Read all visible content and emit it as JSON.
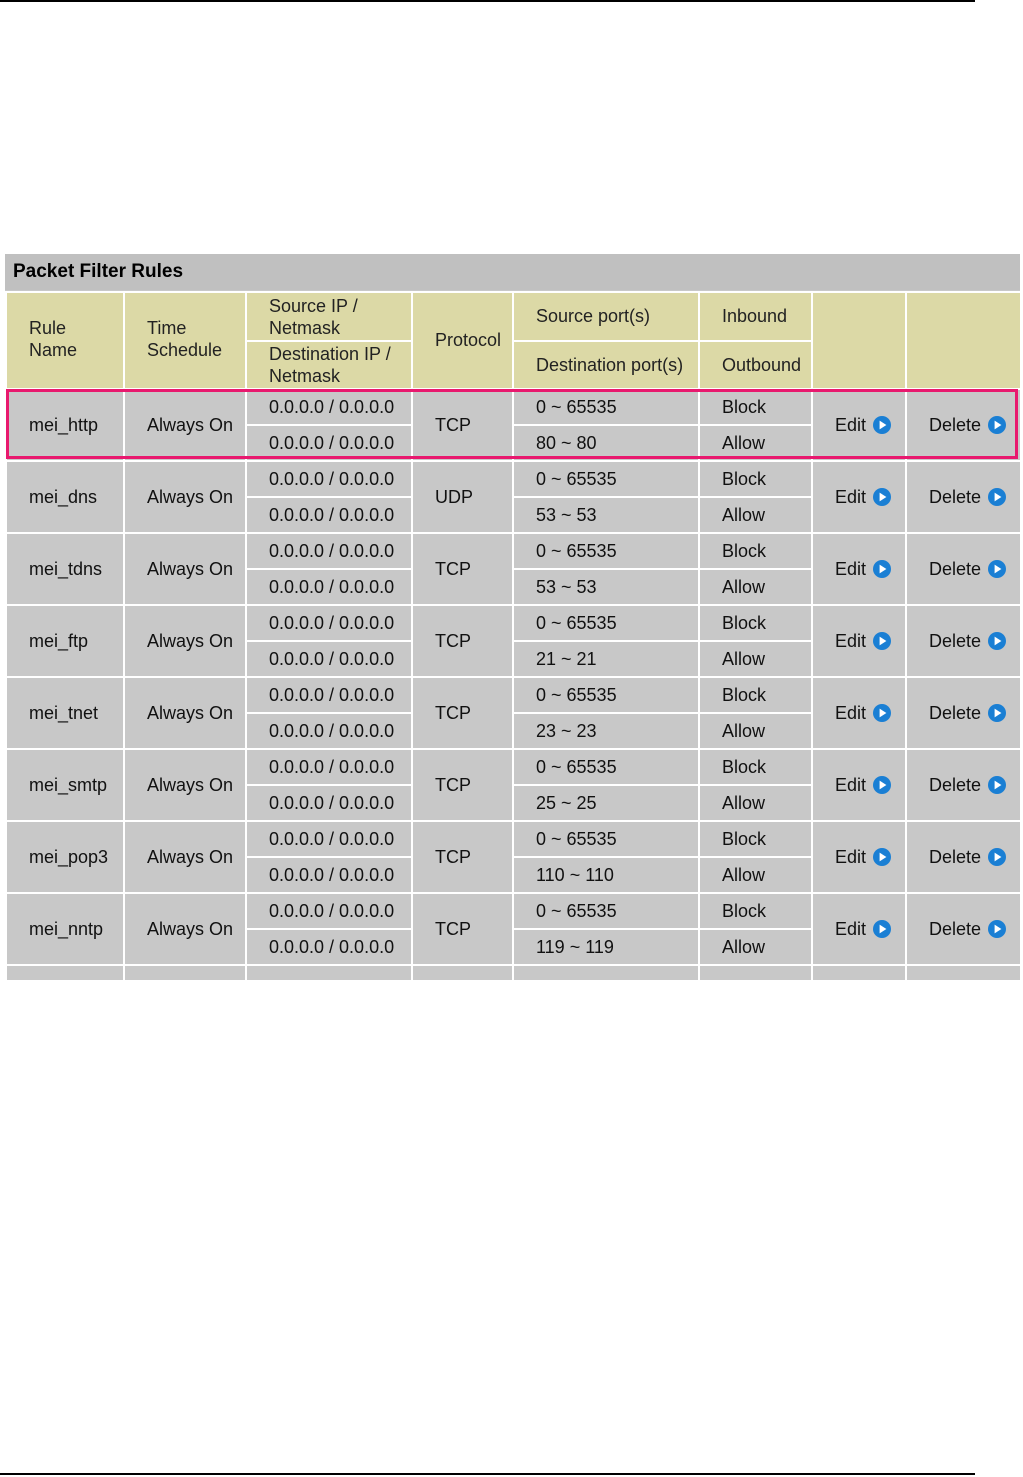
{
  "panel": {
    "title": "Packet Filter Rules"
  },
  "headers": {
    "rule_name": "Rule Name",
    "time_schedule": "Time Schedule",
    "source_ip": "Source IP / Netmask",
    "destination_ip": "Destination IP / Netmask",
    "protocol": "Protocol",
    "source_ports": "Source port(s)",
    "destination_ports": "Destination port(s)",
    "inbound": "Inbound",
    "outbound": "Outbound"
  },
  "actions": {
    "edit_label": "Edit",
    "delete_label": "Delete",
    "icon": "play-circle-icon",
    "link_color": "#2a8ad8"
  },
  "highlight_color": "#e8196e",
  "rules": [
    {
      "name": "mei_http",
      "schedule": "Always On",
      "src_ip": "0.0.0.0 / 0.0.0.0",
      "dst_ip": "0.0.0.0 / 0.0.0.0",
      "protocol": "TCP",
      "src_ports": "0 ~ 65535",
      "dst_ports": "80 ~ 80",
      "inbound": "Block",
      "outbound": "Allow"
    },
    {
      "name": "mei_dns",
      "schedule": "Always On",
      "src_ip": "0.0.0.0 / 0.0.0.0",
      "dst_ip": "0.0.0.0 / 0.0.0.0",
      "protocol": "UDP",
      "src_ports": "0 ~ 65535",
      "dst_ports": "53 ~ 53",
      "inbound": "Block",
      "outbound": "Allow"
    },
    {
      "name": "mei_tdns",
      "schedule": "Always On",
      "src_ip": "0.0.0.0 / 0.0.0.0",
      "dst_ip": "0.0.0.0 / 0.0.0.0",
      "protocol": "TCP",
      "src_ports": "0 ~ 65535",
      "dst_ports": "53 ~ 53",
      "inbound": "Block",
      "outbound": "Allow"
    },
    {
      "name": "mei_ftp",
      "schedule": "Always On",
      "src_ip": "0.0.0.0 / 0.0.0.0",
      "dst_ip": "0.0.0.0 / 0.0.0.0",
      "protocol": "TCP",
      "src_ports": "0 ~ 65535",
      "dst_ports": "21 ~ 21",
      "inbound": "Block",
      "outbound": "Allow"
    },
    {
      "name": "mei_tnet",
      "schedule": "Always On",
      "src_ip": "0.0.0.0 / 0.0.0.0",
      "dst_ip": "0.0.0.0 / 0.0.0.0",
      "protocol": "TCP",
      "src_ports": "0 ~ 65535",
      "dst_ports": "23 ~ 23",
      "inbound": "Block",
      "outbound": "Allow"
    },
    {
      "name": "mei_smtp",
      "schedule": "Always On",
      "src_ip": "0.0.0.0 / 0.0.0.0",
      "dst_ip": "0.0.0.0 / 0.0.0.0",
      "protocol": "TCP",
      "src_ports": "0 ~ 65535",
      "dst_ports": "25 ~ 25",
      "inbound": "Block",
      "outbound": "Allow"
    },
    {
      "name": "mei_pop3",
      "schedule": "Always On",
      "src_ip": "0.0.0.0 / 0.0.0.0",
      "dst_ip": "0.0.0.0 / 0.0.0.0",
      "protocol": "TCP",
      "src_ports": "0 ~ 65535",
      "dst_ports": "110 ~ 110",
      "inbound": "Block",
      "outbound": "Allow"
    },
    {
      "name": "mei_nntp",
      "schedule": "Always On",
      "src_ip": "0.0.0.0 / 0.0.0.0",
      "dst_ip": "0.0.0.0 / 0.0.0.0",
      "protocol": "TCP",
      "src_ports": "0 ~ 65535",
      "dst_ports": "119 ~ 119",
      "inbound": "Block",
      "outbound": "Allow"
    }
  ]
}
